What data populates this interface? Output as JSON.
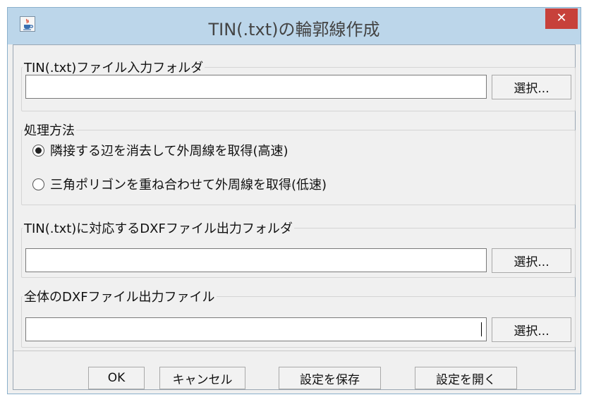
{
  "window": {
    "title": "TIN(.txt)の輪郭線作成",
    "close_glyph": "✕"
  },
  "input_folder": {
    "label": "TIN(.txt)ファイル入力フォルダ",
    "value": "",
    "select_button": "選択..."
  },
  "method": {
    "label": "処理方法",
    "options": [
      {
        "label": "隣接する辺を消去して外周線を取得(高速)",
        "selected": true
      },
      {
        "label": "三角ポリゴンを重ね合わせて外周線を取得(低速)",
        "selected": false
      }
    ]
  },
  "dxf_output_folder": {
    "label": "TIN(.txt)に対応するDXFファイル出力フォルダ",
    "value": "",
    "select_button": "選択..."
  },
  "dxf_output_file": {
    "label": "全体のDXFファイル出力ファイル",
    "value": "",
    "select_button": "選択..."
  },
  "footer": {
    "ok": "OK",
    "cancel": "キャンセル",
    "save": "設定を保存",
    "open": "設定を開く"
  },
  "icons": {
    "app": "java-cup-icon",
    "close": "close-icon"
  }
}
